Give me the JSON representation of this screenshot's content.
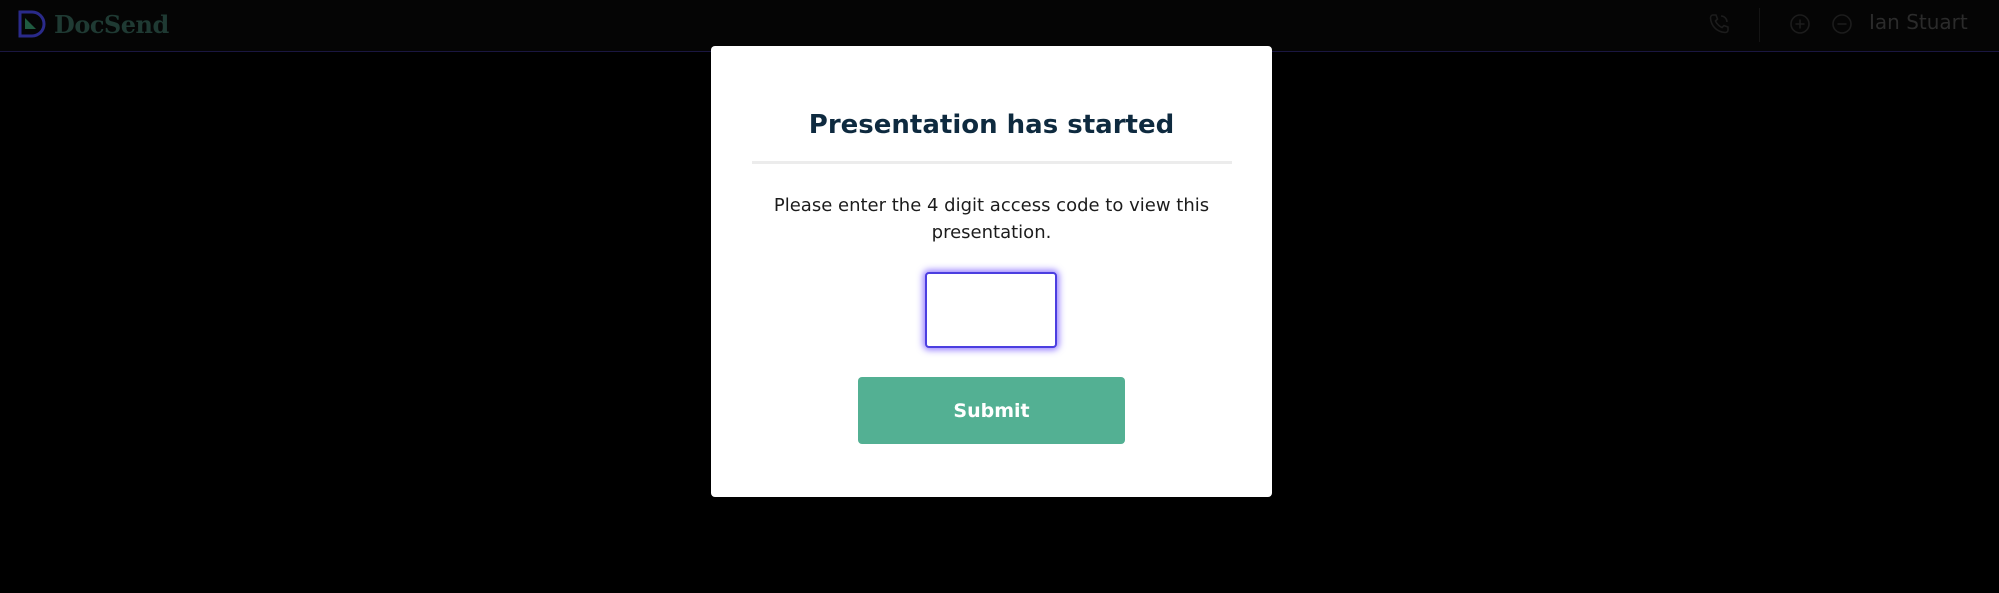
{
  "header": {
    "logo_text": "DocSend",
    "icons": [
      "phone-icon",
      "zoom-in-icon",
      "zoom-out-icon"
    ],
    "user_name": "Ian Stuart"
  },
  "modal": {
    "title": "Presentation has started",
    "message": "Please enter the 4 digit access code to view this presentation.",
    "access_code_value": "",
    "submit_label": "Submit"
  },
  "colors": {
    "background": "#000000",
    "title": "#0e2a3f",
    "submit_button": "#53b093",
    "input_focus": "#6b52ff",
    "logo": "#1f3a33"
  }
}
